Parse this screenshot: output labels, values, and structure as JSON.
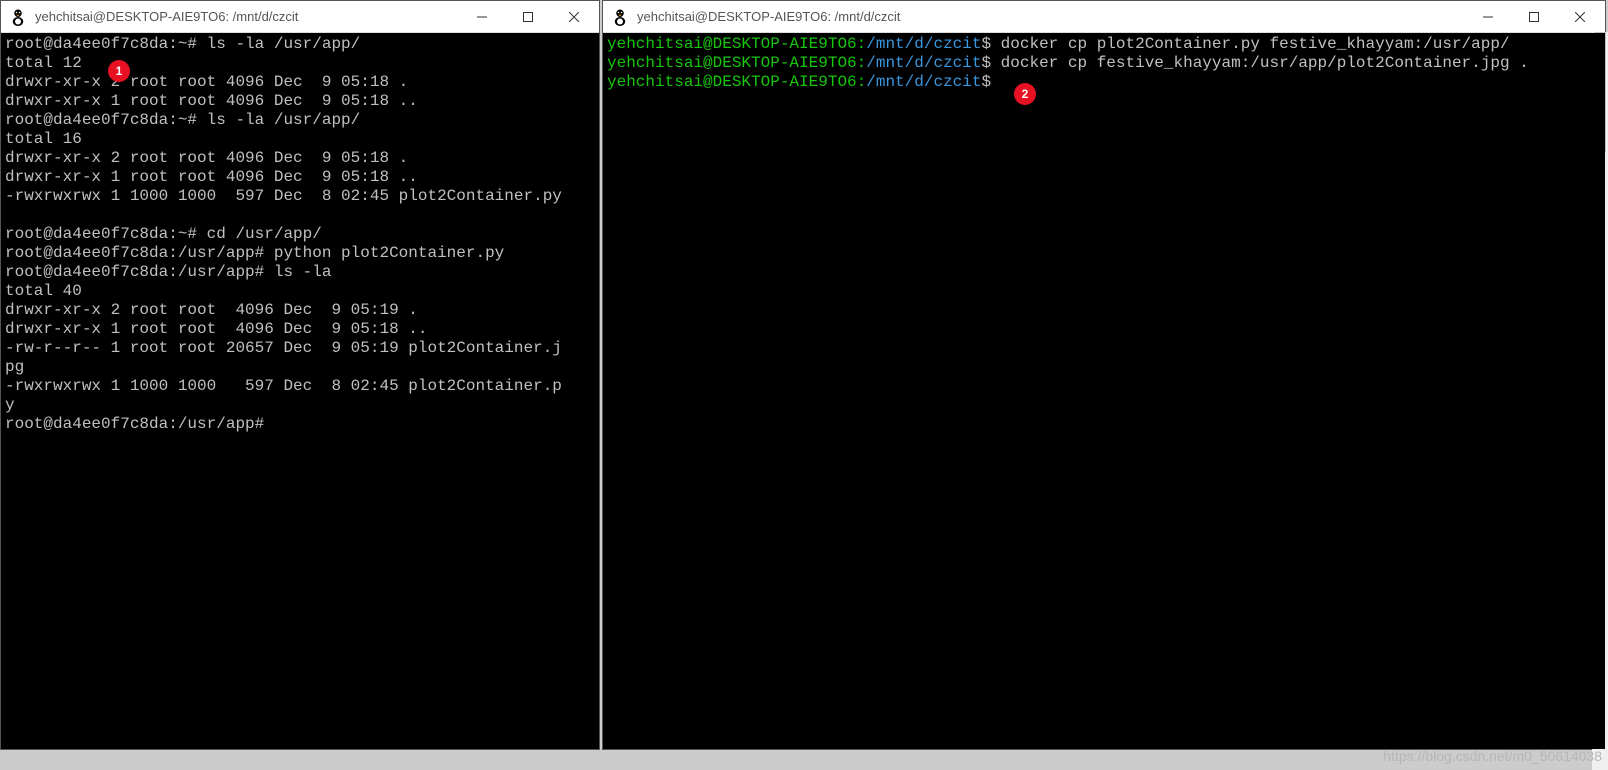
{
  "left_window": {
    "title": "yehchitsai@DESKTOP-AIE9TO6: /mnt/d/czcit",
    "lines": [
      "root@da4ee0f7c8da:~# ls -la /usr/app/",
      "total 12",
      "drwxr-xr-x 2 root root 4096 Dec  9 05:18 .",
      "drwxr-xr-x 1 root root 4096 Dec  9 05:18 ..",
      "root@da4ee0f7c8da:~# ls -la /usr/app/",
      "total 16",
      "drwxr-xr-x 2 root root 4096 Dec  9 05:18 .",
      "drwxr-xr-x 1 root root 4096 Dec  9 05:18 ..",
      "-rwxrwxrwx 1 1000 1000  597 Dec  8 02:45 plot2Container.py",
      "",
      "root@da4ee0f7c8da:~# cd /usr/app/",
      "root@da4ee0f7c8da:/usr/app# python plot2Container.py",
      "root@da4ee0f7c8da:/usr/app# ls -la",
      "total 40",
      "drwxr-xr-x 2 root root  4096 Dec  9 05:19 .",
      "drwxr-xr-x 1 root root  4096 Dec  9 05:18 ..",
      "-rw-r--r-- 1 root root 20657 Dec  9 05:19 plot2Container.j",
      "pg",
      "-rwxrwxrwx 1 1000 1000   597 Dec  8 02:45 plot2Container.p",
      "y",
      "root@da4ee0f7c8da:/usr/app#"
    ]
  },
  "right_window": {
    "title": "yehchitsai@DESKTOP-AIE9TO6: /mnt/d/czcit",
    "prompts": [
      {
        "user_host": "yehchitsai@DESKTOP-AIE9TO6:",
        "path": "/mnt/d/czcit",
        "cmd": "$ docker cp plot2Container.py festive_khayyam:/usr/app/"
      },
      {
        "user_host": "yehchitsai@DESKTOP-AIE9TO6:",
        "path": "/mnt/d/czcit",
        "cmd": "$ docker cp festive_khayyam:/usr/app/plot2Container.jpg ."
      },
      {
        "user_host": "yehchitsai@DESKTOP-AIE9TO6:",
        "path": "/mnt/d/czcit",
        "cmd": "$"
      }
    ]
  },
  "badges": {
    "b1": "1",
    "b2": "2"
  },
  "watermark": "https://blog.csdn.net/m0_50614038"
}
